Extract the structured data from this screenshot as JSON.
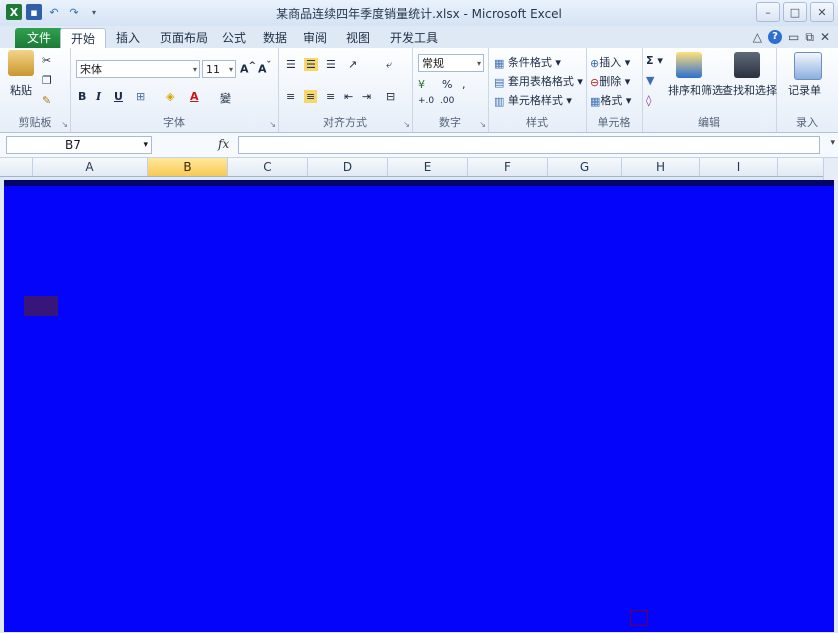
{
  "window": {
    "title": "某商品连续四年季度销量统计.xlsx - Microsoft Excel",
    "buttons": {
      "minimize": "–",
      "restore": "□",
      "close": "✕"
    }
  },
  "tabs": [
    "文件",
    "开始",
    "插入",
    "页面布局",
    "公式",
    "数据",
    "审阅",
    "视图",
    "开发工具"
  ],
  "active_tab": "开始",
  "ribbon": {
    "clipboard": {
      "label": "剪贴板",
      "paste": "粘贴"
    },
    "font": {
      "label": "字体",
      "name": "宋体",
      "size": "11",
      "bold": "B",
      "italic": "I",
      "underline": "U",
      "wen": "變"
    },
    "alignment": {
      "label": "对齐方式"
    },
    "number": {
      "label": "数字",
      "format": "常规",
      "percent": "%",
      "comma": ","
    },
    "styles": {
      "label": "样式",
      "conditional": "条件格式",
      "table": "套用表格格式",
      "cell": "单元格样式"
    },
    "cells": {
      "label": "单元格",
      "insert": "插入",
      "delete": "删除",
      "format": "格式"
    },
    "editing": {
      "label": "编辑",
      "sort": "排序和筛选",
      "find": "查找和选择"
    },
    "record": {
      "label": "录入",
      "button": "记录单"
    }
  },
  "formula_bar": {
    "name_box": "B7",
    "fx": "fx",
    "value": ""
  },
  "columns": [
    "A",
    "B",
    "C",
    "D",
    "E",
    "F",
    "G",
    "H",
    "I"
  ],
  "selected_column": "B",
  "colors": {
    "sheet_overlay": "#0404fa",
    "file_tab": "#1c7a38",
    "selected_header": "#f8c955"
  }
}
